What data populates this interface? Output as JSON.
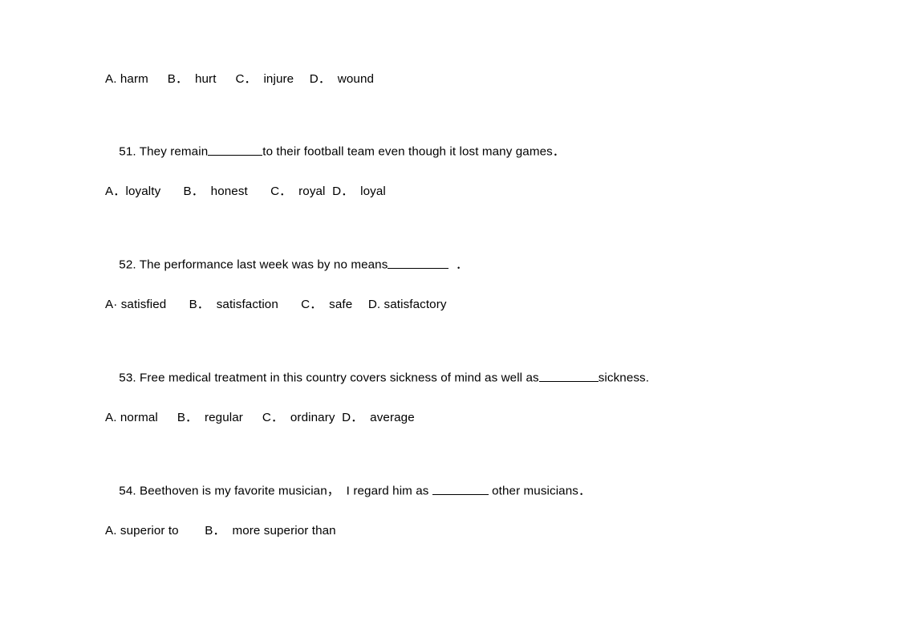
{
  "document": {
    "type": "multiple-choice-exam-worksheet",
    "background_color": "#ffffff",
    "text_color": "#000000"
  },
  "questions": [
    {
      "number": "",
      "stem": "",
      "options_line": "A. harm　  B．  hurt　  C．  injure　 D．  wound"
    },
    {
      "number": "51.",
      "stem_before_blank": "51. They remain",
      "stem_after_blank": "to their football team even though it lost many games．",
      "options_line": "A．loyalty　   B．  honest　   C．  royal  D．  loyal"
    },
    {
      "number": "52.",
      "stem_before_blank": "52. The performance last week was by no means",
      "stem_after_blank": "  ．",
      "options_line": "A· satisfied　   B．  satisfaction　   C．  safe　 D. satisfactory"
    },
    {
      "number": "53.",
      "stem_before_blank": "53. Free medical treatment in this country covers sickness of mind as well as",
      "stem_after_blank": "sickness.",
      "options_line": "A. normal　  B．  regular　  C．  ordinary  D．  average"
    },
    {
      "number": "54.",
      "stem_before_blank": "54. Beethoven is my favorite musician，  I regard him as ",
      "stem_after_blank": " other musicians．",
      "options_line": "A. superior to　    B．  more superior than"
    }
  ]
}
